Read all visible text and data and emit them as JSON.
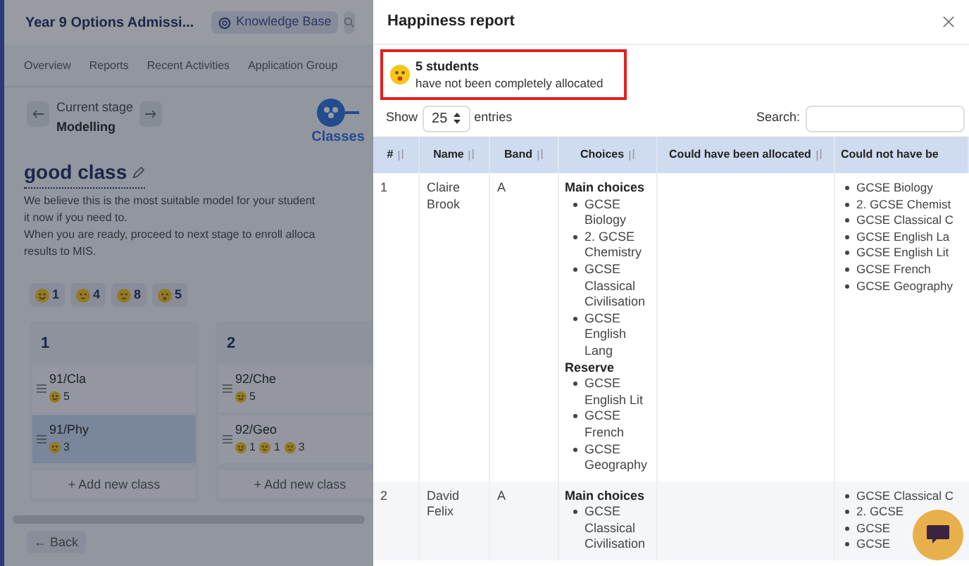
{
  "page": {
    "title": "Year 9 Options Admissi...",
    "knowledge_base": "Knowledge Base",
    "tabs": [
      {
        "label": "Overview",
        "selected": false
      },
      {
        "label": "Reports",
        "selected": false
      },
      {
        "label": "Recent Activities",
        "selected": false
      },
      {
        "label": "Application Group",
        "selected": false
      }
    ],
    "stage": {
      "caption": "Current stage",
      "name": "Modelling",
      "step": "Classes"
    },
    "model_name": "good class",
    "description": [
      "We believe this is the most suitable model for your student",
      "it now if you need to.",
      "When you are ready, proceed to next stage to enroll alloca",
      "results to MIS."
    ],
    "summary": [
      {
        "kind": "happy",
        "count": "1"
      },
      {
        "kind": "content",
        "count": "4"
      },
      {
        "kind": "sad",
        "count": "8"
      },
      {
        "kind": "shocked",
        "count": "5"
      }
    ],
    "columns": [
      {
        "title": "1",
        "classes": [
          {
            "name": "91/Cla",
            "selected": false,
            "faces": [
              {
                "kind": "happy",
                "count": "5"
              }
            ]
          },
          {
            "name": "91/Phy",
            "selected": true,
            "faces": [
              {
                "kind": "sad",
                "count": "3"
              }
            ]
          }
        ],
        "add": "+ Add new class"
      },
      {
        "title": "2",
        "classes": [
          {
            "name": "92/Che",
            "selected": false,
            "faces": [
              {
                "kind": "happy",
                "count": "5"
              }
            ]
          },
          {
            "name": "92/Geo",
            "selected": false,
            "faces": [
              {
                "kind": "happy",
                "count": "1"
              },
              {
                "kind": "content",
                "count": "1"
              },
              {
                "kind": "sad",
                "count": "3"
              }
            ]
          }
        ],
        "add": "+ Add new class"
      }
    ],
    "back": "← Back"
  },
  "report": {
    "title": "Happiness report",
    "alert": {
      "count": "5 students",
      "text": "have not been completely allocated"
    },
    "show": "Show",
    "entries_value": "25",
    "entries": "entries",
    "search_label": "Search:",
    "columns": [
      "#",
      "Name",
      "Band",
      "Choices",
      "Could have been allocated",
      "Could not have be"
    ],
    "rows": [
      {
        "number": "1",
        "name": "Claire Brook",
        "band": "A",
        "choices": [
          {
            "heading": "Main choices",
            "items": [
              "GCSE Biology",
              "2. GCSE Chemistry",
              "GCSE Classical Civilisation",
              "GCSE English Lang"
            ]
          },
          {
            "heading": "Reserve",
            "items": [
              "GCSE English Lit",
              "GCSE French",
              "GCSE Geography"
            ]
          }
        ],
        "not_allocated": [
          "GCSE Biology",
          "2. GCSE Chemist",
          "GCSE Classical C",
          "GCSE English La",
          "GCSE English Lit",
          "GCSE French",
          "GCSE Geography"
        ]
      },
      {
        "number": "2",
        "name": "David Felix",
        "band": "A",
        "choices": [
          {
            "heading": "Main choices",
            "items": [
              "GCSE Classical Civilisation"
            ]
          }
        ],
        "not_allocated": [
          "GCSE Classical C",
          "2. GCSE",
          "GCSE",
          "GCSE"
        ]
      }
    ]
  }
}
